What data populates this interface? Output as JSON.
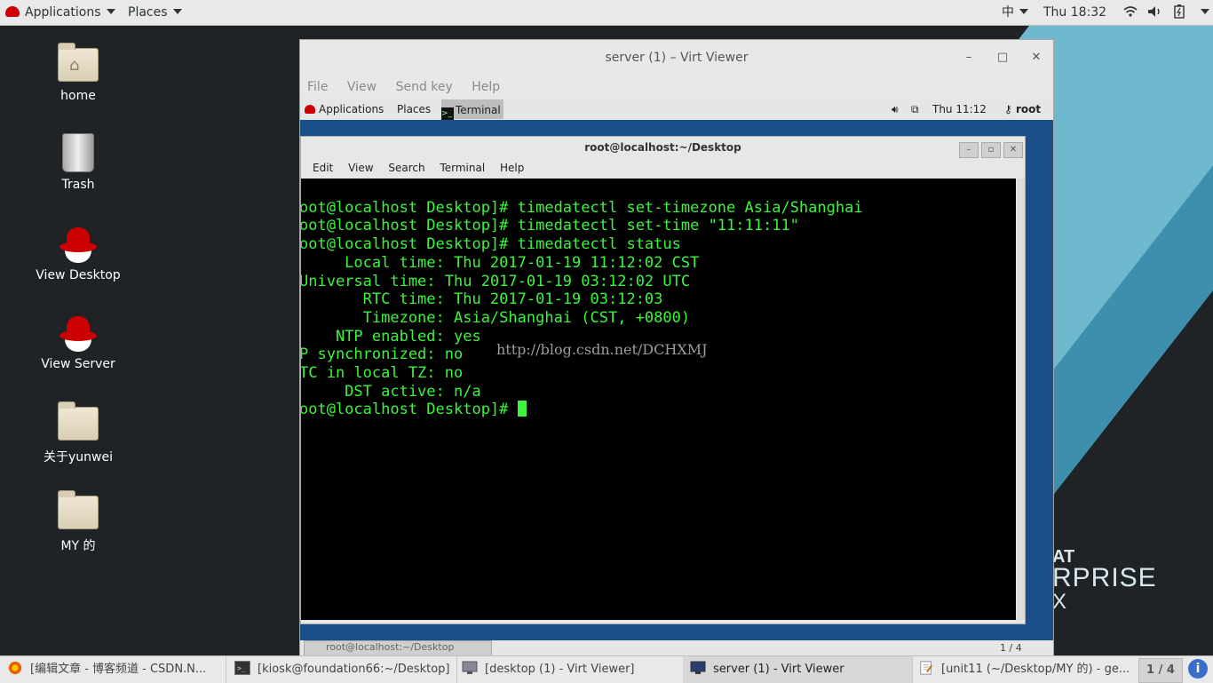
{
  "top_panel": {
    "applications": "Applications",
    "places": "Places",
    "input_method": "中",
    "clock": "Thu 18:32"
  },
  "desktop_icons": [
    {
      "label": "home"
    },
    {
      "label": "Trash"
    },
    {
      "label": "View Desktop"
    },
    {
      "label": "View Server"
    },
    {
      "label": "关于yunwei"
    },
    {
      "label": "MY 的"
    }
  ],
  "background_text": {
    "line1": "AT",
    "line2": "RPRISE",
    "line3": "X"
  },
  "virt_viewer": {
    "title": "server (1) – Virt Viewer",
    "menu": [
      "File",
      "View",
      "Send key",
      "Help"
    ],
    "guest_panel": {
      "applications": "Applications",
      "places": "Places",
      "terminal_task": "Terminal",
      "clock": "Thu 11:12",
      "user": "root"
    },
    "terminal": {
      "title": "root@localhost:~/Desktop",
      "menu": [
        "Edit",
        "View",
        "Search",
        "Terminal",
        "Help"
      ],
      "lines": [
        "oot@localhost Desktop]# timedatectl set-timezone Asia/Shanghai",
        "oot@localhost Desktop]# timedatectl set-time \"11:11:11\"",
        "oot@localhost Desktop]# timedatectl status",
        "     Local time: Thu 2017-01-19 11:12:02 CST",
        "Universal time: Thu 2017-01-19 03:12:02 UTC",
        "       RTC time: Thu 2017-01-19 03:12:03",
        "       Timezone: Asia/Shanghai (CST, +0800)",
        "    NTP enabled: yes",
        "P synchronized: no",
        "TC in local TZ: no",
        "     DST active: n/a"
      ],
      "prompt": "oot@localhost Desktop]# ",
      "watermark": "http://blog.csdn.net/DCHXMJ"
    },
    "guest_bottom": {
      "task": "root@localhost:~/Desktop",
      "page": "1 / 4"
    }
  },
  "taskbar": {
    "tasks": [
      "[编辑文章 - 博客频道 - CSDN.N...",
      "[kiosk@foundation66:~/Desktop]",
      "[desktop (1) - Virt Viewer]",
      "server (1) - Virt Viewer",
      "[unit11 (~/Desktop/MY 的) - ge..."
    ],
    "pager": "1 / 4",
    "tray": "i"
  }
}
